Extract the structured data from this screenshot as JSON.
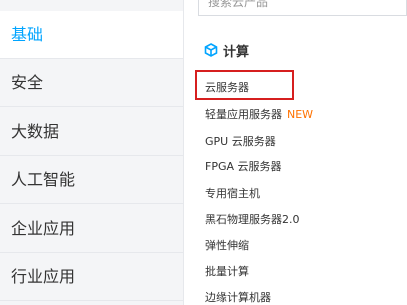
{
  "sidebar": {
    "items": [
      {
        "label": "基础"
      },
      {
        "label": "安全"
      },
      {
        "label": "大数据"
      },
      {
        "label": "人工智能"
      },
      {
        "label": "企业应用"
      },
      {
        "label": "行业应用"
      }
    ]
  },
  "search": {
    "placeholder": "搜索云产品"
  },
  "section": {
    "title": "计算",
    "icon": "cube-icon"
  },
  "menu": {
    "items": [
      {
        "label": "云服务器"
      },
      {
        "label": "轻量应用服务器",
        "badge": "NEW"
      },
      {
        "label": "GPU 云服务器"
      },
      {
        "label": "FPGA 云服务器"
      },
      {
        "label": "专用宿主机"
      },
      {
        "label": "黑石物理服务器2.0"
      },
      {
        "label": "弹性伸缩"
      },
      {
        "label": "批量计算"
      },
      {
        "label": "边缘计算机器"
      }
    ]
  },
  "colors": {
    "accent": "#00a4ff",
    "badge": "#ff7200",
    "highlight": "#d61f1f"
  }
}
